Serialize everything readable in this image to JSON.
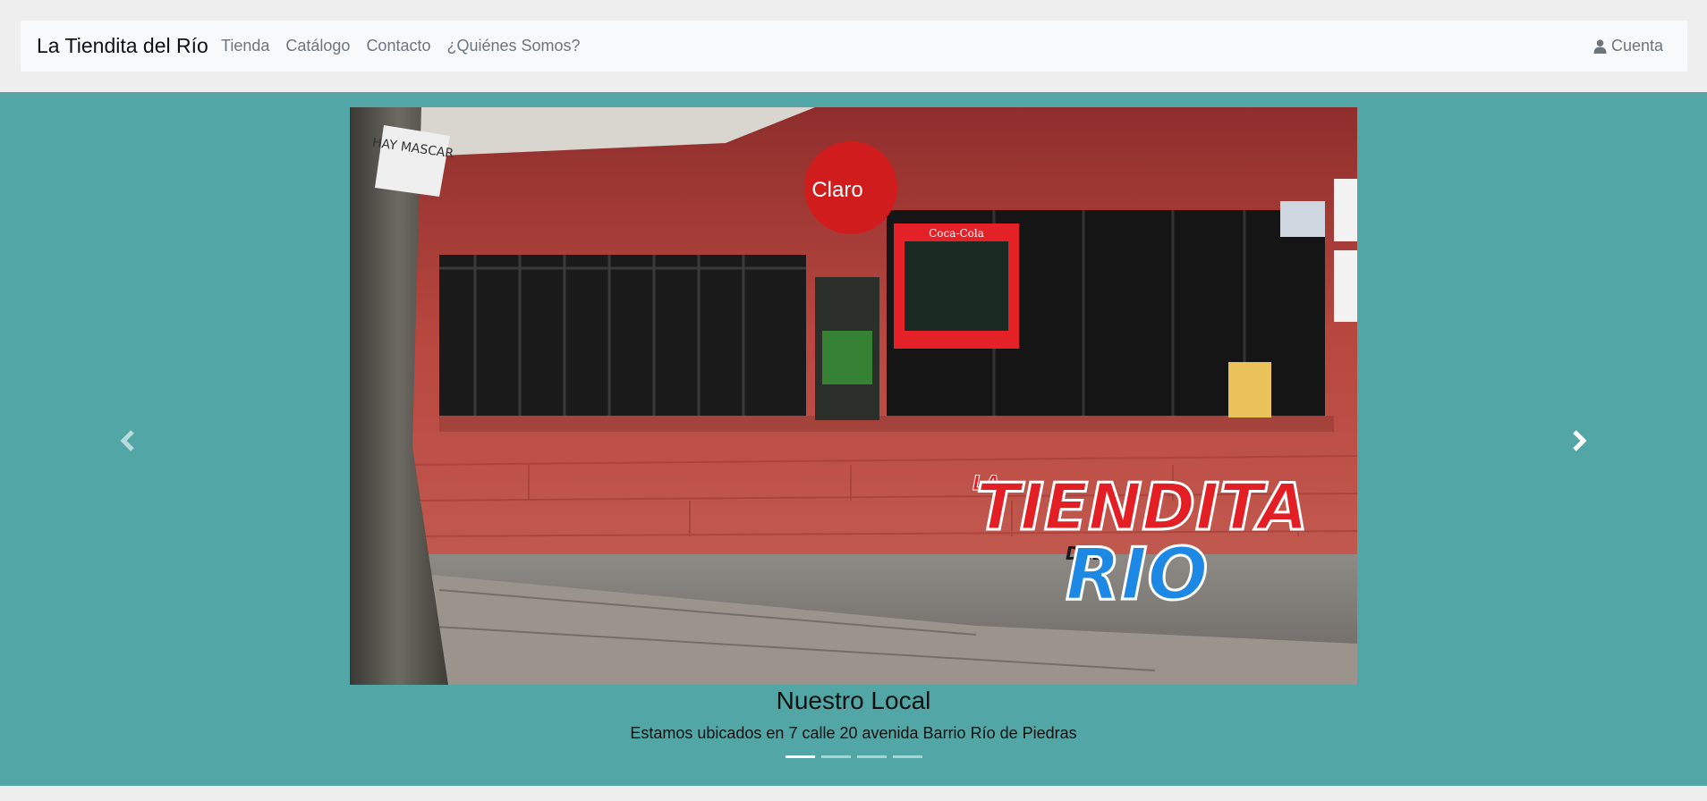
{
  "navbar": {
    "brand": "La Tiendita del Río",
    "links": [
      "Tienda",
      "Catálogo",
      "Contacto",
      "¿Quiénes Somos?"
    ],
    "account_label": "Cuenta",
    "account_icon": "user-icon"
  },
  "carousel": {
    "slide": {
      "title": "Nuestro Local",
      "text": "Estamos ubicados en 7 calle 20 avenida Barrio Río de Piedras",
      "image_signs": {
        "claro": "Claro",
        "cocacola": "Coca-Cola",
        "handwritten": "HAY MASCAR",
        "logo_line1": "LA",
        "logo_line2": "TIENDITA",
        "logo_line3": "DEL",
        "logo_line4": "RIO"
      }
    },
    "indicator_count": 4,
    "active_indicator": 0,
    "prev_icon": "chevron-left-icon",
    "next_icon": "chevron-right-icon"
  },
  "colors": {
    "carousel_bg": "#52a6a5",
    "navbar_bg": "#f8f9fa",
    "page_bg": "#eeeeee",
    "wall": "#b84a44"
  }
}
